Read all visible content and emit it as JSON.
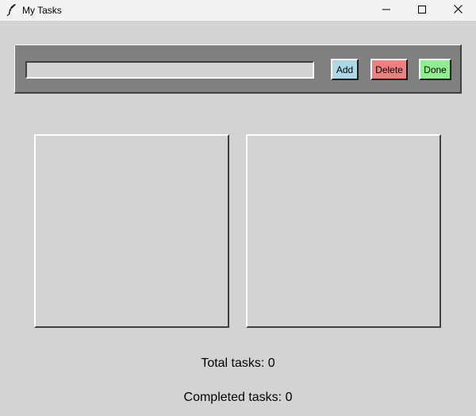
{
  "window": {
    "title": "My Tasks",
    "icon": "feather-icon"
  },
  "toolbar": {
    "task_input_value": "",
    "add_label": "Add",
    "delete_label": "Delete",
    "done_label": "Done",
    "colors": {
      "frame": "#808080",
      "add": "#add8e6",
      "delete": "#f08080",
      "done": "#90ee90"
    }
  },
  "lists": {
    "pending_tasks": [],
    "completed_tasks": []
  },
  "status": {
    "total": "Total tasks: 0",
    "completed": "Completed tasks: 0"
  }
}
